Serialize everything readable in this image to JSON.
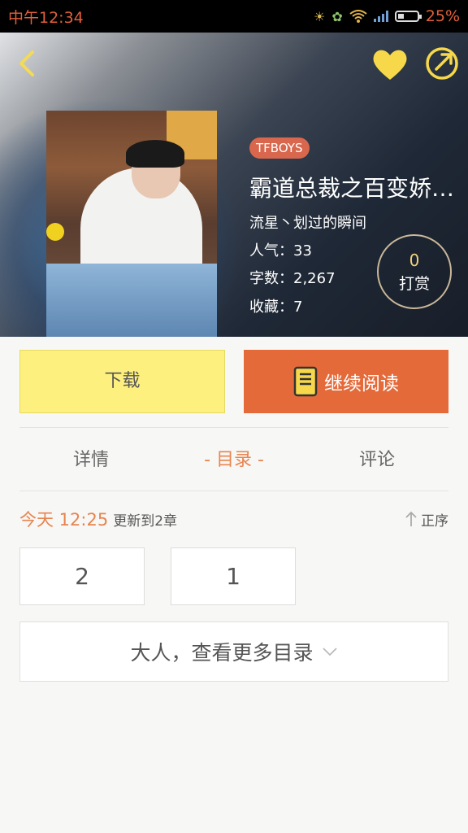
{
  "status_bar": {
    "time": "中午12:34",
    "battery_percent": "25%",
    "icons": [
      "alarm-icon",
      "leaf-icon",
      "wifi-icon",
      "signal-icon",
      "battery-icon"
    ]
  },
  "header": {
    "back_icon": "chevron-left-icon",
    "favorite_icon": "heart-icon",
    "share_icon": "share-icon",
    "accent_color": "#f6d84a"
  },
  "book": {
    "tag": "TFBOYS",
    "title": "霸道总裁之百变娇…",
    "author": "流星丶划过的瞬间",
    "popularity": "人气：33",
    "word_count": "字数：2,267",
    "favorites": "收藏：7"
  },
  "tip": {
    "count": "0",
    "label": "打赏"
  },
  "actions": {
    "download_label": "下载",
    "continue_label": "继续阅读"
  },
  "tabs": [
    {
      "label": "详情"
    },
    {
      "label": "- 目录 -"
    },
    {
      "label": "评论"
    }
  ],
  "catalog": {
    "update_time": "今天 12:25",
    "update_info": "更新到2章",
    "sort_label": "正序",
    "chapters": [
      "2",
      "1"
    ],
    "more_label": "大人，查看更多目录"
  }
}
